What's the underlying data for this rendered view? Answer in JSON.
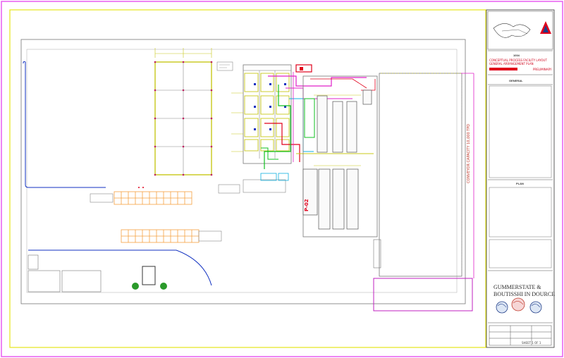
{
  "drawing": {
    "colors": {
      "sheet_border": "#e95cf0",
      "frame": "#e6e61a",
      "plan_line": "#666666",
      "pipe_red": "#e0001b",
      "pipe_magenta": "#e020c8",
      "pipe_green": "#10c020",
      "pipe_cyan": "#10b0e0",
      "tank_orange": "#f5a040",
      "yard_blue": "#1030c0"
    },
    "plan_labels": {
      "rotated_right": "CONVEYOR CAPACITY 10,000 TPD",
      "red_tag": "P-02"
    }
  },
  "title_block": {
    "project_number": "1004",
    "project_lines": [
      "CONCEPTUAL PROCESS FACILITY LAYOUT",
      "GENERAL ARRANGEMENT PLAN"
    ],
    "stamp": "PRELIMINARY",
    "sheet_title": "GENERAL",
    "section_label": "PLAN",
    "company_lines": [
      "GUMMERSTATE &",
      "BOUTISSHI IN DOURCE"
    ],
    "footer_text": "SHEET 1 OF 1"
  }
}
